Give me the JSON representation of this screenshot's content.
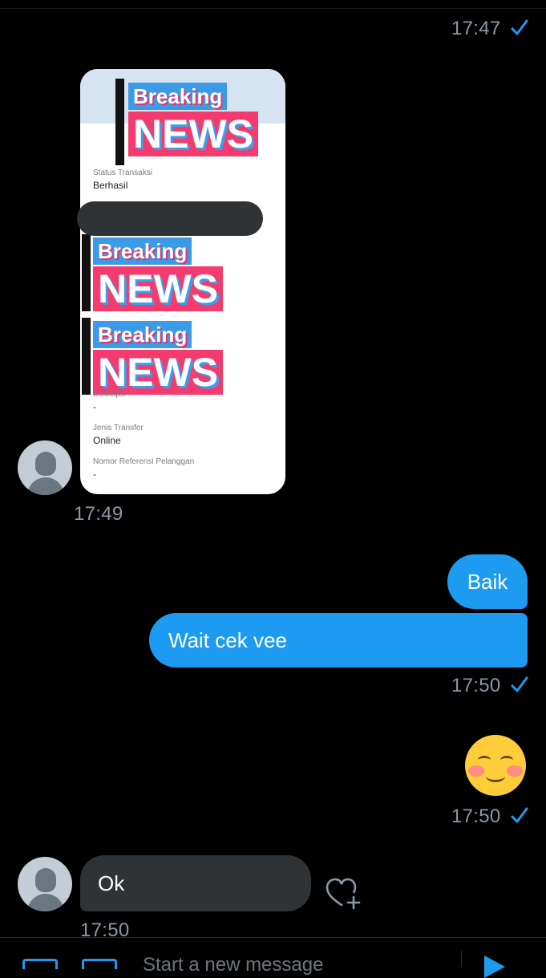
{
  "conversation": {
    "timestamps": {
      "first_sent": "17:47",
      "receipt_received": "17:49",
      "replies_sent": "17:50",
      "emoji_sent": "17:50",
      "ok_received": "17:50"
    },
    "receipt": {
      "headline_small": "Breaking",
      "headline_big": "NEWS",
      "status_label": "Status Transaksi",
      "status_value": "Berhasil",
      "desc_label": "Deskripsi",
      "desc_value": "-",
      "type_label": "Jenis Transfer",
      "type_value": "Online",
      "ref_label": "Nomor Referensi Pelanggan",
      "ref_value": "-"
    },
    "messages_out": [
      "Baik",
      "Wait cek vee"
    ],
    "message_in": "Ok"
  },
  "composer": {
    "placeholder": "Start a new message"
  },
  "colors": {
    "accent": "#1d9bf0",
    "incoming_bubble": "#2f3336",
    "timestamp": "#8b98a5",
    "background": "#000000"
  },
  "icons": [
    "sent-check-icon",
    "default-avatar-icon",
    "like-heart-plus-icon",
    "gif-icon",
    "image-icon",
    "send-icon"
  ]
}
